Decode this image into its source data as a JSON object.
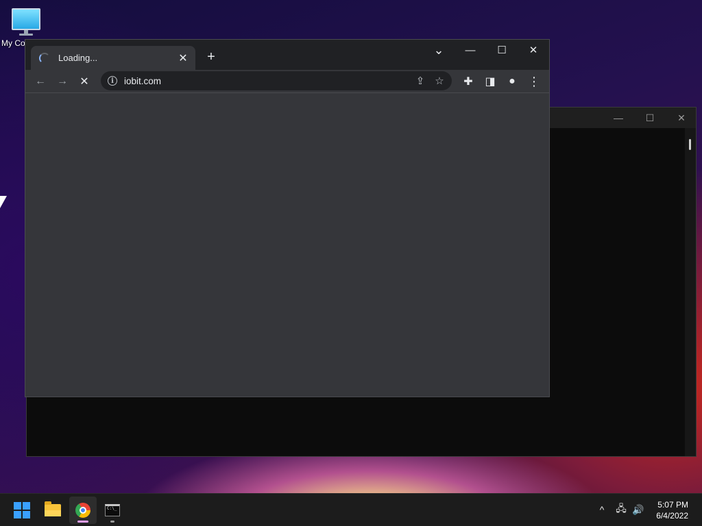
{
  "desktop": {
    "icon_label": "My Co"
  },
  "terminal_window": {
    "minimize": "—",
    "maximize": "☐",
    "close": "✕"
  },
  "browser": {
    "tab": {
      "title": "Loading...",
      "close": "✕"
    },
    "new_tab": "+",
    "tab_search": "⌄",
    "window_controls": {
      "minimize": "—",
      "maximize": "☐",
      "close": "✕"
    },
    "toolbar": {
      "back": "←",
      "forward": "→",
      "stop": "✕"
    },
    "omnibox": {
      "info": "i",
      "url": "iobit.com",
      "share": "⇪",
      "bookmark": "☆"
    },
    "extensions": "✚",
    "side_panel": "◨",
    "profile": "●",
    "menu": "⋮"
  },
  "taskbar": {
    "apps": [
      "start",
      "file-explorer",
      "chrome",
      "command-prompt"
    ],
    "tray": {
      "overflow": "^",
      "network": "🖧",
      "volume": "🔊"
    },
    "clock": {
      "time": "5:07 PM",
      "date": "6/4/2022"
    }
  }
}
